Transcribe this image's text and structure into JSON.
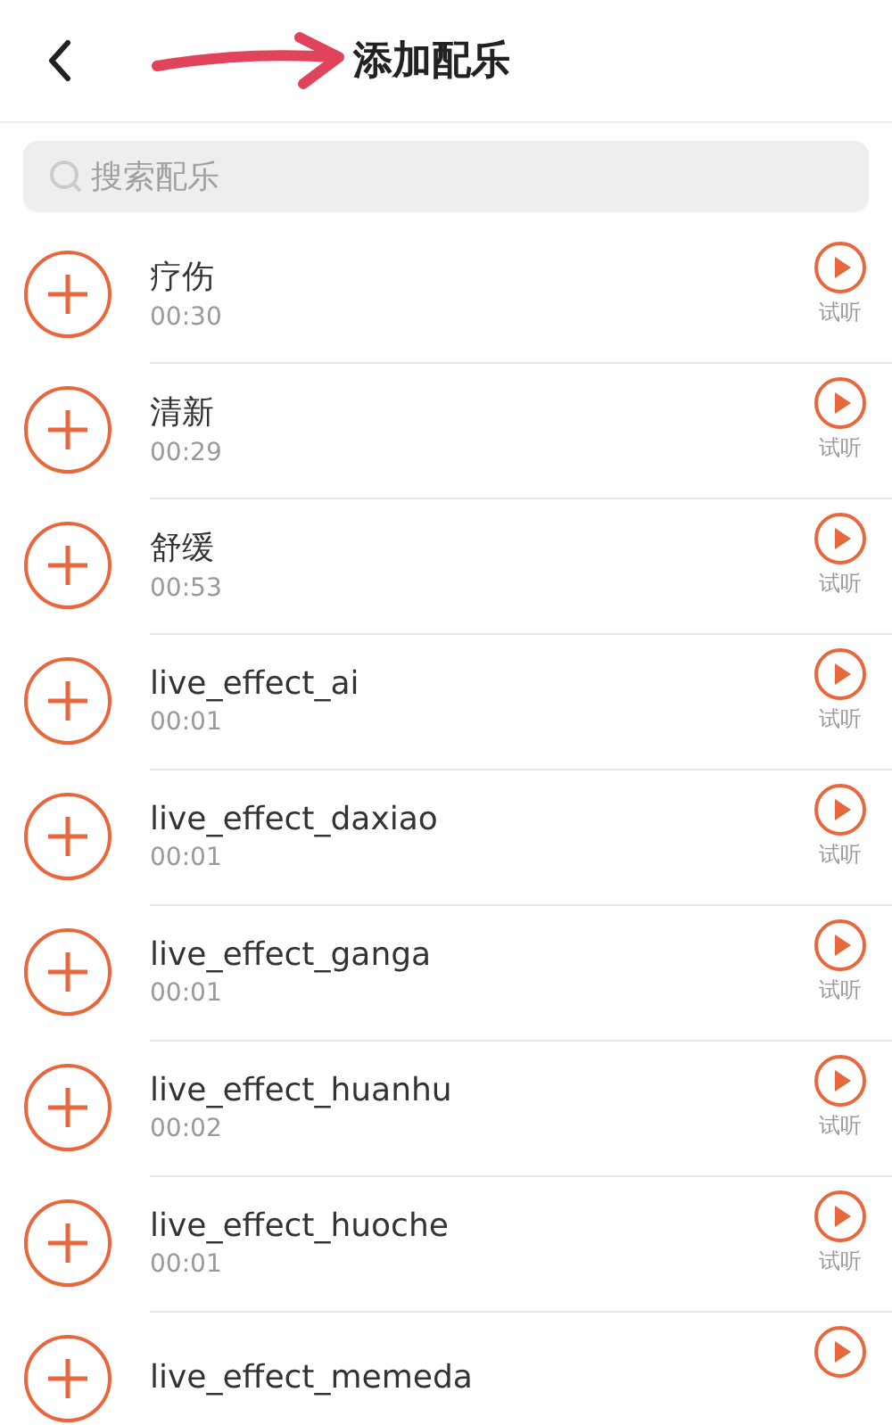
{
  "header": {
    "title": "添加配乐"
  },
  "search": {
    "placeholder": "搜索配乐"
  },
  "tracks": [
    {
      "name": "疗伤",
      "duration": "00:30",
      "preview": "试听"
    },
    {
      "name": "清新",
      "duration": "00:29",
      "preview": "试听"
    },
    {
      "name": "舒缓",
      "duration": "00:53",
      "preview": "试听"
    },
    {
      "name": "live_effect_ai",
      "duration": "00:01",
      "preview": "试听"
    },
    {
      "name": "live_effect_daxiao",
      "duration": "00:01",
      "preview": "试听"
    },
    {
      "name": "live_effect_ganga",
      "duration": "00:01",
      "preview": "试听"
    },
    {
      "name": "live_effect_huanhu",
      "duration": "00:02",
      "preview": "试听"
    },
    {
      "name": "live_effect_huoche",
      "duration": "00:01",
      "preview": "试听"
    },
    {
      "name": "live_effect_memeda"
    }
  ]
}
